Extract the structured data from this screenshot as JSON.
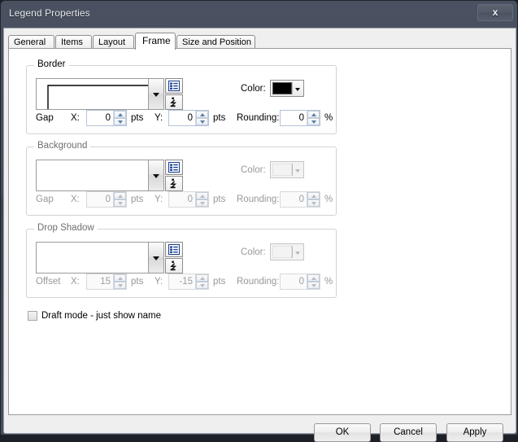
{
  "window": {
    "title": "Legend Properties",
    "close_label": "x"
  },
  "tabs": [
    {
      "label": "General",
      "active": false
    },
    {
      "label": "Items",
      "active": false
    },
    {
      "label": "Layout",
      "active": false
    },
    {
      "label": "Frame",
      "active": true
    },
    {
      "label": "Size and Position",
      "active": false
    }
  ],
  "groups": {
    "border": {
      "title": "Border",
      "enabled": true,
      "style_combo": {
        "value": "",
        "preview": "line-corner"
      },
      "list_button_icon": "list-icon",
      "info_button_icon": "formula-icon",
      "color_label": "Color:",
      "color_value": "#000000",
      "offset_label": "Gap",
      "x_label": "X:",
      "x_value": "0",
      "x_units": "pts",
      "y_label": "Y:",
      "y_value": "0",
      "y_units": "pts",
      "rounding_label": "Rounding:",
      "rounding_value": "0",
      "rounding_units": "%"
    },
    "background": {
      "title": "Background",
      "enabled": false,
      "style_combo": {
        "value": "",
        "preview": "empty"
      },
      "list_button_icon": "list-icon",
      "info_button_icon": "formula-icon",
      "color_label": "Color:",
      "color_value": "",
      "offset_label": "Gap",
      "x_label": "X:",
      "x_value": "0",
      "x_units": "pts",
      "y_label": "Y:",
      "y_value": "0",
      "y_units": "pts",
      "rounding_label": "Rounding:",
      "rounding_value": "0",
      "rounding_units": "%"
    },
    "dropshadow": {
      "title": "Drop Shadow",
      "enabled": false,
      "style_combo": {
        "value": "",
        "preview": "empty"
      },
      "list_button_icon": "list-icon",
      "info_button_icon": "formula-icon",
      "color_label": "Color:",
      "color_value": "",
      "offset_label": "Offset",
      "x_label": "X:",
      "x_value": "15",
      "x_units": "pts",
      "y_label": "Y:",
      "y_value": "-15",
      "y_units": "pts",
      "rounding_label": "Rounding:",
      "rounding_value": "0",
      "rounding_units": "%"
    }
  },
  "draft_mode": {
    "label": "Draft mode - just show name",
    "checked": false
  },
  "footer": {
    "ok_label": "OK",
    "cancel_label": "Cancel",
    "apply_label": "Apply"
  },
  "colors": {
    "titlebar": "#454c5a",
    "client_bg": "#efefef",
    "tabpage_bg": "#ffffff",
    "border_color_swatch": "#000000",
    "spinner_border": "#b4c4d8"
  }
}
